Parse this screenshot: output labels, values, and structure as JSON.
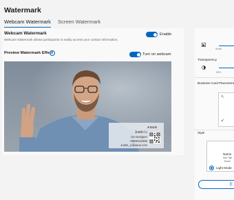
{
  "page": {
    "title": "Watermark"
  },
  "tabs": [
    {
      "label": "Webcam Watermark",
      "active": true
    },
    {
      "label": "Screen Watermark",
      "active": false
    }
  ],
  "webcam_watermark": {
    "title": "Webcam Watermark",
    "description": "Webcam Watermark allows participants to easily access your contact information.",
    "toggle_label": "Enable",
    "toggle_on": true
  },
  "preview": {
    "title": "Preview Watermark Effect",
    "toggle_label": "Turn on webcam",
    "toggle_on": true
  },
  "watermark_card": {
    "logo": "ASUS",
    "name": "Justin Li",
    "role": "UX Designer",
    "phone": "+8869123456",
    "email": "Justin_Li@asus.com"
  },
  "right_panel": {
    "size_small_label": "Small",
    "transparency_label": "Transparency",
    "transparency_value": "50%",
    "placement_label": "Business Card Placement",
    "style_label": "Style",
    "style_card_name": "Name",
    "style_card_subtitle": "Sub Title",
    "style_card_email": "Email",
    "radio_label": "Light Mode",
    "button_label": "E"
  },
  "colors": {
    "accent": "#0067c0",
    "background": "#f3f3f3"
  }
}
